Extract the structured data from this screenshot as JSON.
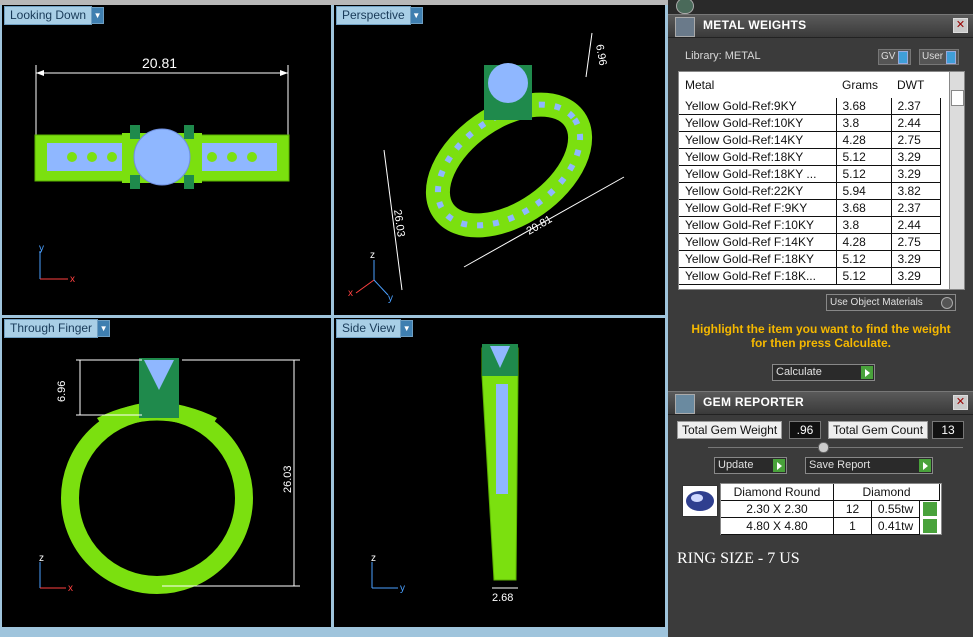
{
  "viewports": [
    {
      "label": "Looking Down",
      "dims": [
        "20.81"
      ],
      "axes": [
        "y",
        "x"
      ]
    },
    {
      "label": "Perspective",
      "dims": [
        "6.96",
        "26.03",
        "20.81"
      ],
      "axes": [
        "z",
        "x",
        "y"
      ]
    },
    {
      "label": "Through Finger",
      "dims": [
        "6.96",
        "26.03"
      ],
      "axes": [
        "z",
        "x"
      ]
    },
    {
      "label": "Side View",
      "dims": [
        "2.68"
      ],
      "axes": [
        "z",
        "y"
      ]
    }
  ],
  "metal_weights": {
    "title": "METAL WEIGHTS",
    "library_label": "Library: METAL",
    "gv_label": "GV",
    "user_label": "User",
    "columns": [
      "Metal",
      "Grams",
      "DWT"
    ],
    "rows": [
      [
        "Yellow Gold-Ref:9KY",
        "3.68",
        "2.37"
      ],
      [
        "Yellow Gold-Ref:10KY",
        "3.8",
        "2.44"
      ],
      [
        "Yellow Gold-Ref:14KY",
        "4.28",
        "2.75"
      ],
      [
        "Yellow Gold-Ref:18KY",
        "5.12",
        "3.29"
      ],
      [
        "Yellow Gold-Ref:18KY ...",
        "5.12",
        "3.29"
      ],
      [
        "Yellow Gold-Ref:22KY",
        "5.94",
        "3.82"
      ],
      [
        "Yellow Gold-Ref F:9KY",
        "3.68",
        "2.37"
      ],
      [
        "Yellow Gold-Ref F:10KY",
        "3.8",
        "2.44"
      ],
      [
        "Yellow Gold-Ref F:14KY",
        "4.28",
        "2.75"
      ],
      [
        "Yellow Gold-Ref F:18KY",
        "5.12",
        "3.29"
      ],
      [
        "Yellow Gold-Ref F:18K...",
        "5.12",
        "3.29"
      ]
    ],
    "use_object_materials": "Use Object Materials",
    "hint": "Highlight the item you want to find the weight for then press Calculate.",
    "calculate_label": "Calculate"
  },
  "gem_reporter": {
    "title": "GEM REPORTER",
    "total_weight_label": "Total Gem Weight",
    "total_weight_value": ".96",
    "total_count_label": "Total Gem Count",
    "total_count_value": "13",
    "update_label": "Update",
    "save_label": "Save Report",
    "header_shape": "Diamond Round",
    "header_type": "Diamond",
    "rows": [
      {
        "size": "2.30 X 2.30",
        "count": "12",
        "weight": "0.55tw"
      },
      {
        "size": "4.80 X 4.80",
        "count": "1",
        "weight": "0.41tw"
      }
    ],
    "ring_size": "RING SIZE - 7 US"
  },
  "colors": {
    "ring_green": "#7be00f",
    "stone_blue": "#8fb7ff",
    "prong_green": "#1f8a4c",
    "hint_yellow": "#f5b800"
  }
}
